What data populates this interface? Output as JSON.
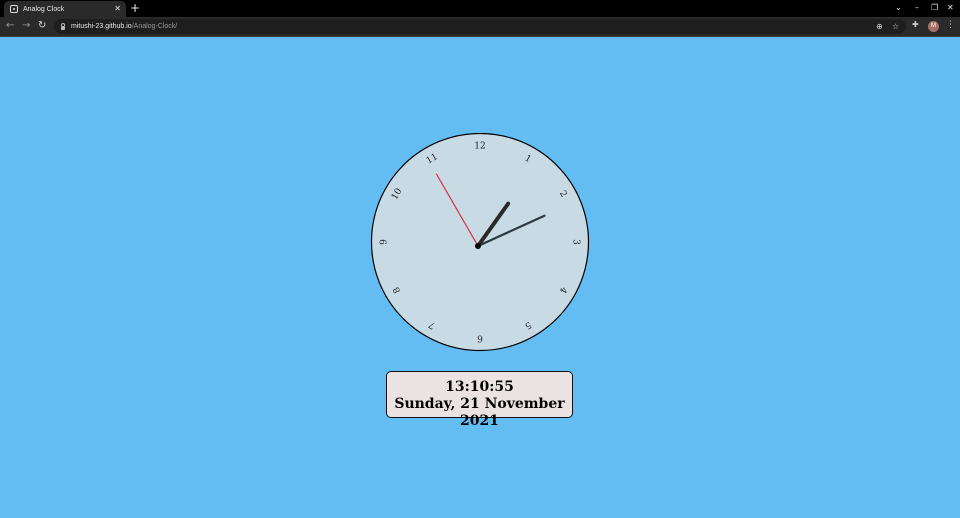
{
  "browser": {
    "tab_title": "Analog Clock",
    "url_host": "mitushi-23.github.io",
    "url_path": "/Analog-Clock/",
    "avatar_letter": "M",
    "icons": {
      "back": "back-arrow-icon",
      "forward": "forward-arrow-icon",
      "reload": "reload-icon",
      "zoom": "zoom-icon",
      "bookmark": "star-icon",
      "extensions": "puzzle-icon",
      "menu": "kebab-menu-icon"
    }
  },
  "clock": {
    "numerals": [
      "12",
      "1",
      "2",
      "3",
      "4",
      "5",
      "6",
      "7",
      "8",
      "9",
      "10",
      "11"
    ],
    "time": {
      "hours": 13,
      "minutes": 10,
      "seconds": 55
    },
    "colors": {
      "face": "#c8dbe5",
      "hour_hand": "#2a2a2a",
      "minute_hand": "#2f3a40",
      "second_hand": "#e0283c",
      "background": "#63bdf3"
    }
  },
  "display": {
    "time": "13:10:55",
    "date": "Sunday, 21 November 2021"
  }
}
